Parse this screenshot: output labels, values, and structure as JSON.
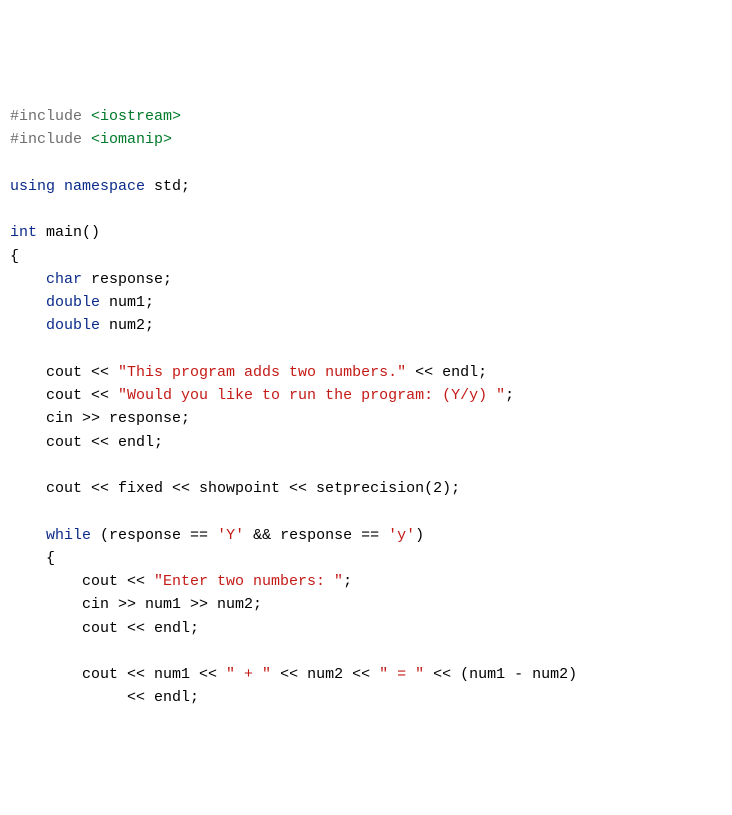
{
  "line1": {
    "pp": "#include",
    "hdr": " <iostream>"
  },
  "line2": {
    "pp": "#include",
    "hdr": " <iomanip>"
  },
  "blank": "",
  "line4": {
    "kw1": "using",
    "kw2": " namespace",
    "rest": " std;"
  },
  "line6": {
    "kw": "int",
    "rest": " main()"
  },
  "line7": "{",
  "line8": {
    "indent": "    ",
    "kw": "char",
    "rest": " response;"
  },
  "line9": {
    "indent": "    ",
    "kw": "double",
    "rest": " num1;"
  },
  "line10": {
    "indent": "    ",
    "kw": "double",
    "rest": " num2;"
  },
  "line12": {
    "indent": "    ",
    "a": "cout << ",
    "s": "\"This program adds two numbers.\"",
    "b": " << endl;"
  },
  "line13": {
    "indent": "    ",
    "a": "cout << ",
    "s": "\"Would you like to run the program: (Y/y) \"",
    "b": ";"
  },
  "line14": {
    "indent": "    ",
    "a": "cin >> response;"
  },
  "line15": {
    "indent": "    ",
    "a": "cout << endl;"
  },
  "line17": {
    "indent": "    ",
    "a": "cout << fixed << showpoint << setprecision(2);"
  },
  "line19": {
    "indent": "    ",
    "kw": "while",
    "a": " (response == ",
    "s1": "'Y'",
    "b": " && response == ",
    "s2": "'y'",
    "c": ")"
  },
  "line20": {
    "indent": "    ",
    "a": "{"
  },
  "line21": {
    "indent": "        ",
    "a": "cout << ",
    "s": "\"Enter two numbers: \"",
    "b": ";"
  },
  "line22": {
    "indent": "        ",
    "a": "cin >> num1 >> num2;"
  },
  "line23": {
    "indent": "        ",
    "a": "cout << endl;"
  },
  "line25": {
    "indent": "        ",
    "a": "cout << num1 << ",
    "s1": "\" + \"",
    "b": " << num2 << ",
    "s2": "\" = \"",
    "c": " << (num1 - num2)"
  },
  "line26": {
    "indent": "             ",
    "a": "<< endl;"
  }
}
